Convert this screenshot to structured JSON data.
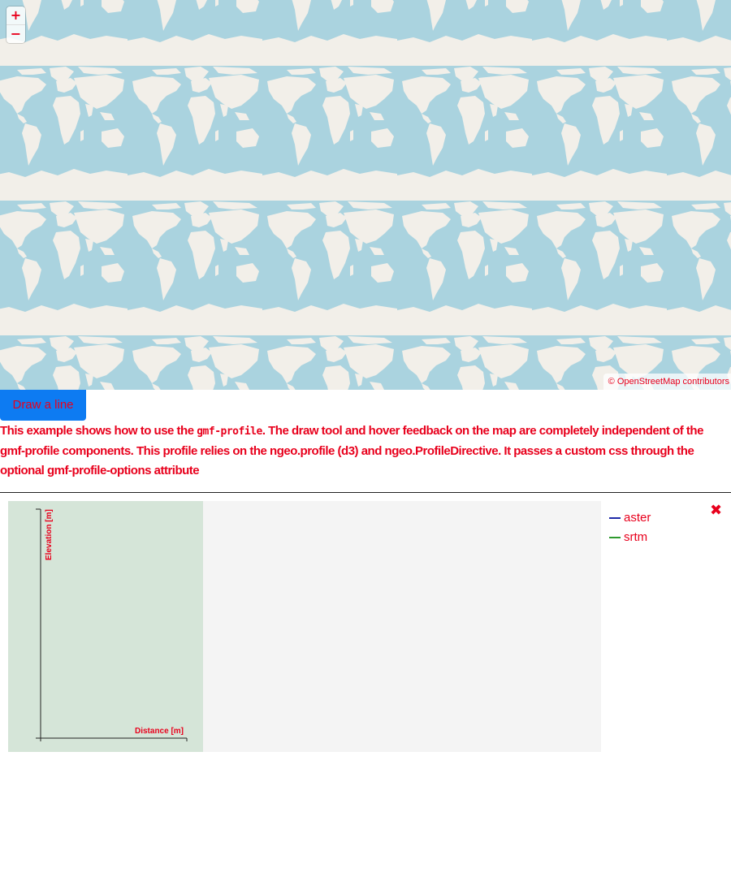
{
  "map": {
    "zoom_in": "+",
    "zoom_out": "−",
    "attribution": "© OpenStreetMap contributors"
  },
  "controls": {
    "draw_label": "Draw a line"
  },
  "description": {
    "part1": "This example shows how to use the ",
    "code": "gmf-profile",
    "part2": ". The draw tool and hover feedback on the map are completely independent of the gmf-profile components. This profile relies on the ngeo.profile (d3) and ngeo.ProfileDirective. It passes a custom css through the optional gmf-profile-options attribute"
  },
  "profile": {
    "y_axis_label": "Elevation [m]",
    "x_axis_label": "Distance [m]",
    "legend": [
      {
        "name": "aster",
        "color": "#1f2aa8"
      },
      {
        "name": "srtm",
        "color": "#2e9a2e"
      }
    ],
    "close_icon": "✖"
  },
  "colors": {
    "text": "#e8001c",
    "button": "#0d7bf2",
    "water": "#aad3df",
    "land": "#f2efe9"
  }
}
